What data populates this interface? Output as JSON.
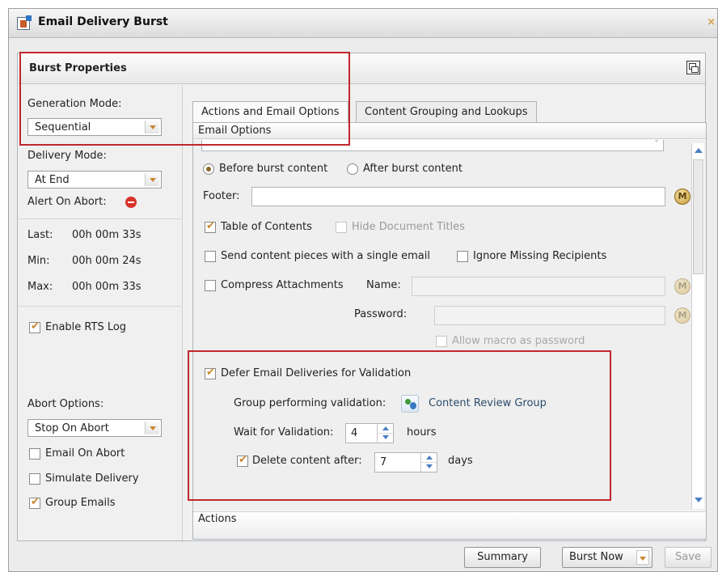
{
  "window": {
    "title": "Email Delivery Burst",
    "close_glyph": "×"
  },
  "panel": {
    "title": "Burst Properties"
  },
  "left": {
    "generation_mode_label": "Generation Mode:",
    "generation_mode_value": "Sequential",
    "delivery_mode_label": "Delivery Mode:",
    "delivery_mode_value": "At End",
    "alert_on_abort_label": "Alert On Abort:",
    "stats": [
      {
        "label": "Last:",
        "value": "00h 00m 33s"
      },
      {
        "label": "Min:",
        "value": "00h 00m 24s"
      },
      {
        "label": "Max:",
        "value": "00h 00m 33s"
      }
    ],
    "enable_rts_log": {
      "label": "Enable RTS Log",
      "checked": true
    },
    "abort_options_label": "Abort Options:",
    "abort_options_value": "Stop On Abort",
    "email_on_abort": {
      "label": "Email On Abort",
      "checked": false
    },
    "simulate_delivery": {
      "label": "Simulate Delivery",
      "checked": false
    },
    "group_emails": {
      "label": "Group Emails",
      "checked": true
    }
  },
  "tabs": [
    {
      "label": "Actions and Email Options",
      "active": true
    },
    {
      "label": "Content Grouping and Lookups",
      "active": false
    }
  ],
  "email_options": {
    "section_title": "Email Options",
    "placement_options": [
      "Before burst content",
      "After burst content"
    ],
    "placement_selected": "Before burst content",
    "footer_label": "Footer:",
    "footer_value": "",
    "table_of_contents": {
      "label": "Table of Contents",
      "checked": true
    },
    "hide_document_titles": {
      "label": "Hide Document Titles",
      "checked": false,
      "disabled": true
    },
    "send_single_email": {
      "label": "Send content pieces with a single email",
      "checked": false
    },
    "ignore_missing_recipients": {
      "label": "Ignore Missing Recipients",
      "checked": false
    },
    "compress_attachments": {
      "label": "Compress Attachments",
      "checked": false
    },
    "name_label": "Name:",
    "password_label": "Password:",
    "allow_macro_password": {
      "label": "Allow macro as password",
      "checked": false,
      "disabled": true
    },
    "macro_glyph": "M",
    "defer_validation": {
      "label": "Defer Email Deliveries for Validation",
      "checked": true
    },
    "group_validation_label": "Group performing validation:",
    "group_validation_value": "Content Review Group",
    "wait_label": "Wait for Validation:",
    "wait_value": "4",
    "wait_unit": "hours",
    "delete_after": {
      "label": "Delete content after:",
      "checked": true
    },
    "delete_value": "7",
    "delete_unit": "days"
  },
  "actions_section_title": "Actions",
  "footer_buttons": {
    "summary": "Summary",
    "burst_now": "Burst Now",
    "save": "Save"
  },
  "colors": {
    "highlight_red": "#c0282d",
    "accent_orange": "#c9872e",
    "link_blue": "#2a4c6c"
  },
  "icons": [
    "document-icon",
    "close-icon",
    "restore-icon",
    "abort-icon",
    "checkbox-icon",
    "macro-icon",
    "group-icon",
    "spinner-icon",
    "dropdown-arrow-icon"
  ]
}
